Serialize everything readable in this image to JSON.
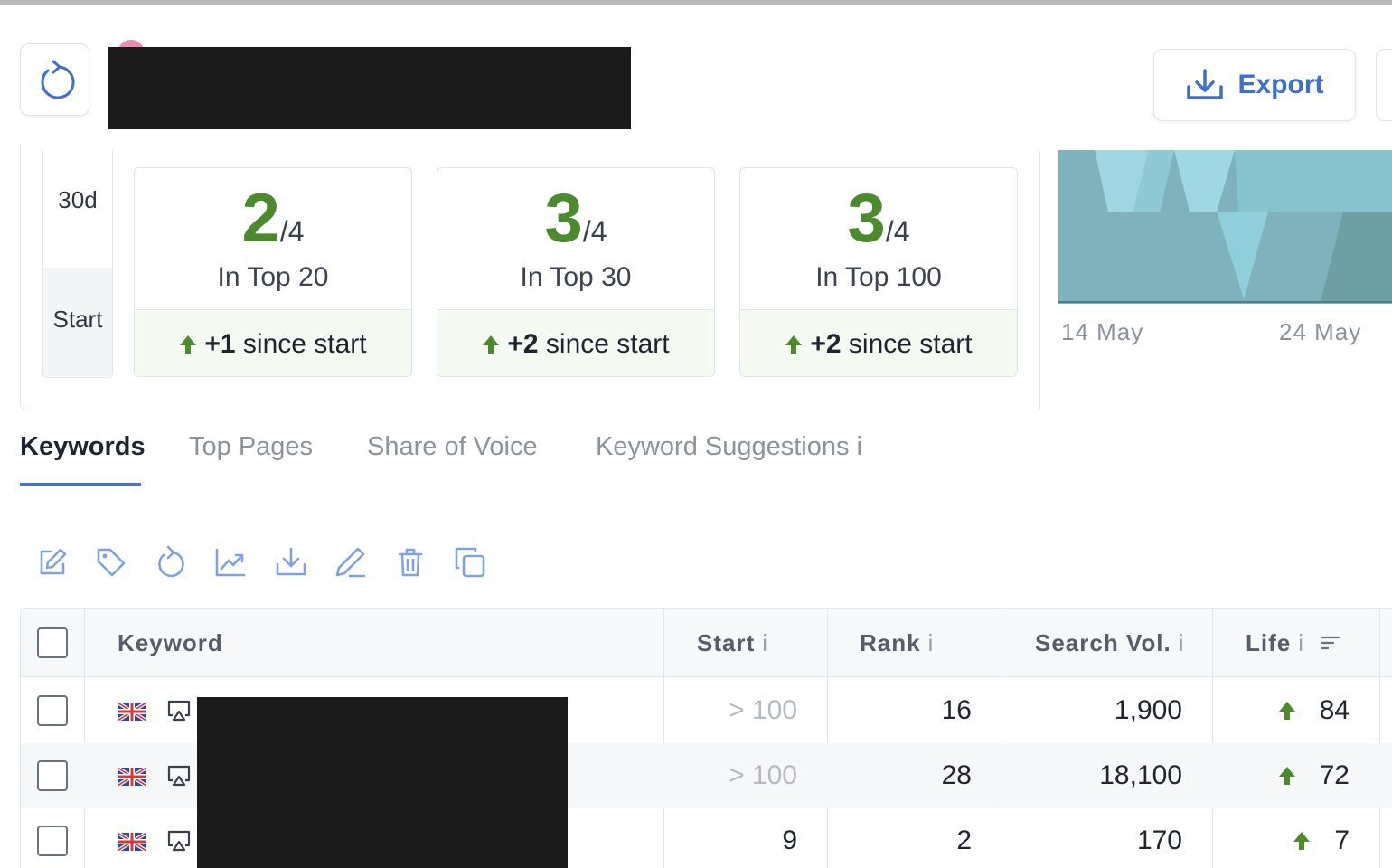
{
  "header": {
    "export_label": "Export"
  },
  "period": {
    "current": "30d",
    "start": "Start"
  },
  "stats": [
    {
      "value": "2",
      "total": "/4",
      "label": "In Top 20",
      "change": "+1",
      "change_suffix": " since start"
    },
    {
      "value": "3",
      "total": "/4",
      "label": "In Top 30",
      "change": "+2",
      "change_suffix": " since start"
    },
    {
      "value": "3",
      "total": "/4",
      "label": "In Top 100",
      "change": "+2",
      "change_suffix": " since start"
    }
  ],
  "chart": {
    "dates": [
      "14 May",
      "24 May"
    ]
  },
  "tabs": [
    {
      "label": "Keywords",
      "active": true
    },
    {
      "label": "Top Pages"
    },
    {
      "label": "Share of Voice"
    },
    {
      "label": "Keyword Suggestions i"
    }
  ],
  "toolbar": {
    "icons": [
      "edit-icon",
      "tag-icon",
      "refresh-icon",
      "chart-icon",
      "download-icon",
      "pen-icon",
      "trash-icon",
      "copy-icon"
    ]
  },
  "table": {
    "headers": {
      "keyword": "Keyword",
      "start": "Start",
      "rank": "Rank",
      "search_vol": "Search Vol.",
      "life": "Life",
      "info": "i"
    },
    "rows": [
      {
        "start": "> 100",
        "rank": "16",
        "search_vol": "1,900",
        "life": "84"
      },
      {
        "start": "> 100",
        "rank": "28",
        "search_vol": "18,100",
        "life": "72"
      },
      {
        "start": "9",
        "rank": "2",
        "search_vol": "170",
        "life": "7"
      }
    ]
  },
  "colors": {
    "accent": "#3e6fcc",
    "positive": "#4b8a2d",
    "chart_fill": "#7fb6c2"
  }
}
